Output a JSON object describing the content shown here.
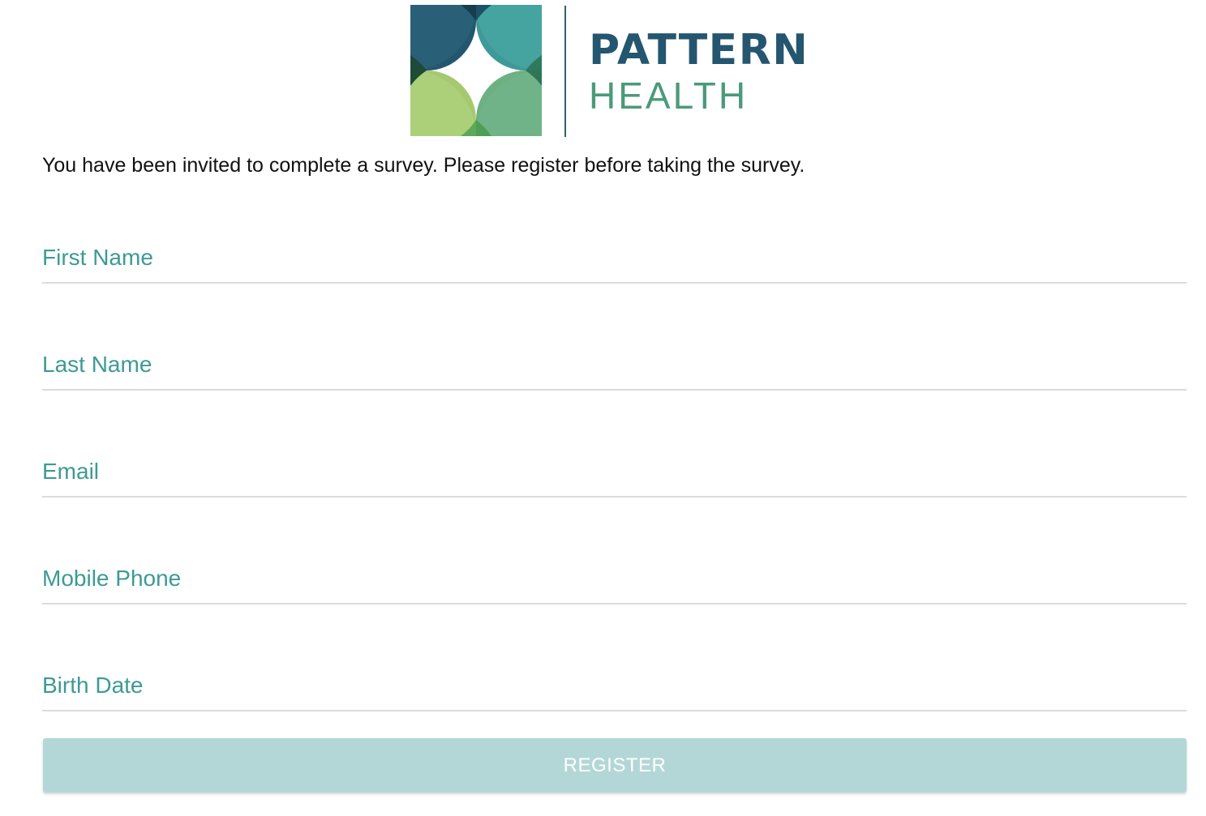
{
  "brand": {
    "name_line1": "PATTERN",
    "name_line2": "HEALTH",
    "logo_icon": "pattern-health-star-logo",
    "colors": {
      "navy": "#245670",
      "teal": "#3d9a95",
      "green": "#4b9a7a",
      "light_green": "#a6c96f"
    }
  },
  "intro": {
    "text": "You have been invited to complete a survey. Please register before taking the survey."
  },
  "form": {
    "fields": [
      {
        "label": "First Name",
        "value": ""
      },
      {
        "label": "Last Name",
        "value": ""
      },
      {
        "label": "Email",
        "value": ""
      },
      {
        "label": "Mobile Phone",
        "value": ""
      },
      {
        "label": "Birth Date",
        "value": ""
      }
    ],
    "label_color": "#3d9a95",
    "register_label": "REGISTER",
    "register_color": "#b3d7d7"
  }
}
